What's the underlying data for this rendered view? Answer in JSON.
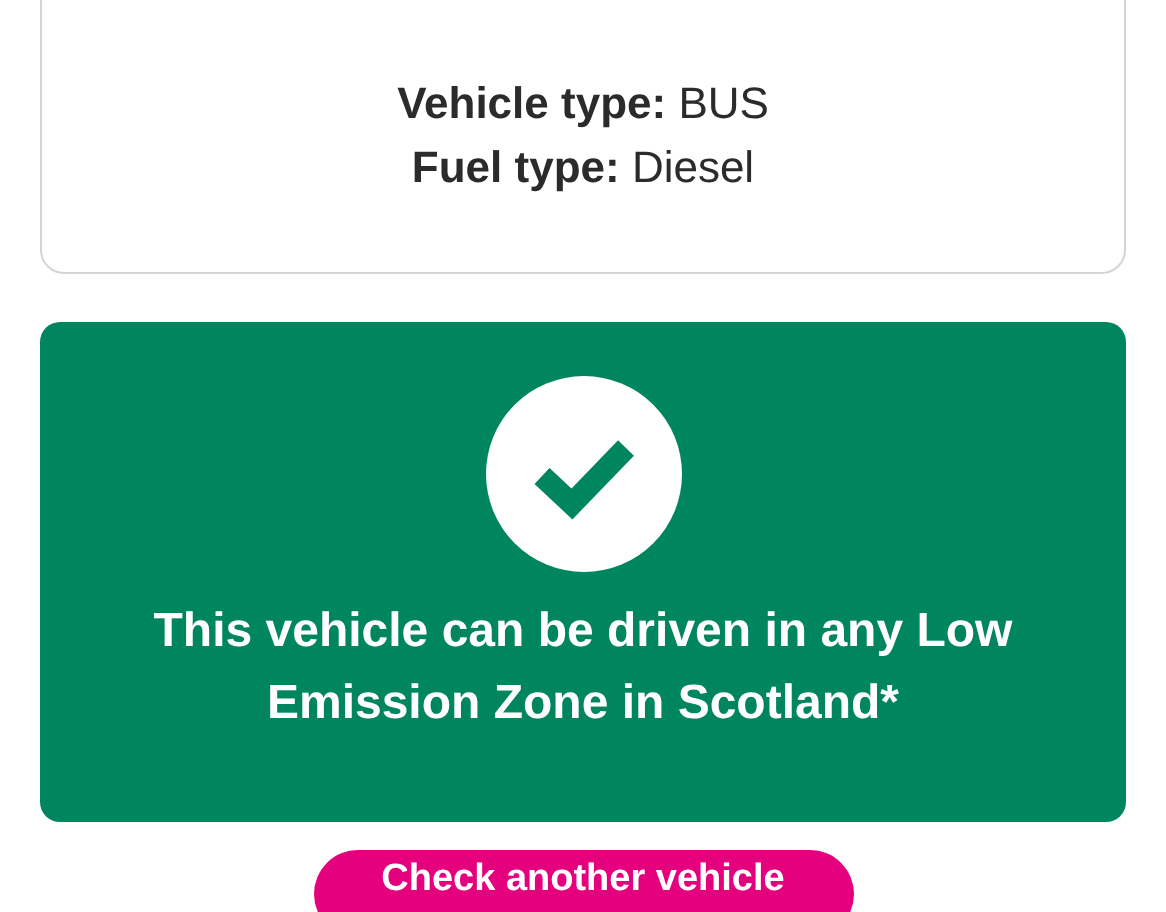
{
  "vehicle_details": [
    "**Vehicle type:** BUS",
    "**Fuel type:** Diesel"
  ],
  "result": {
    "compliant": true,
    "message": "This vehicle can be driven in any Low Emission Zone in Scotland*"
  },
  "button": "Check another vehicle"
}
